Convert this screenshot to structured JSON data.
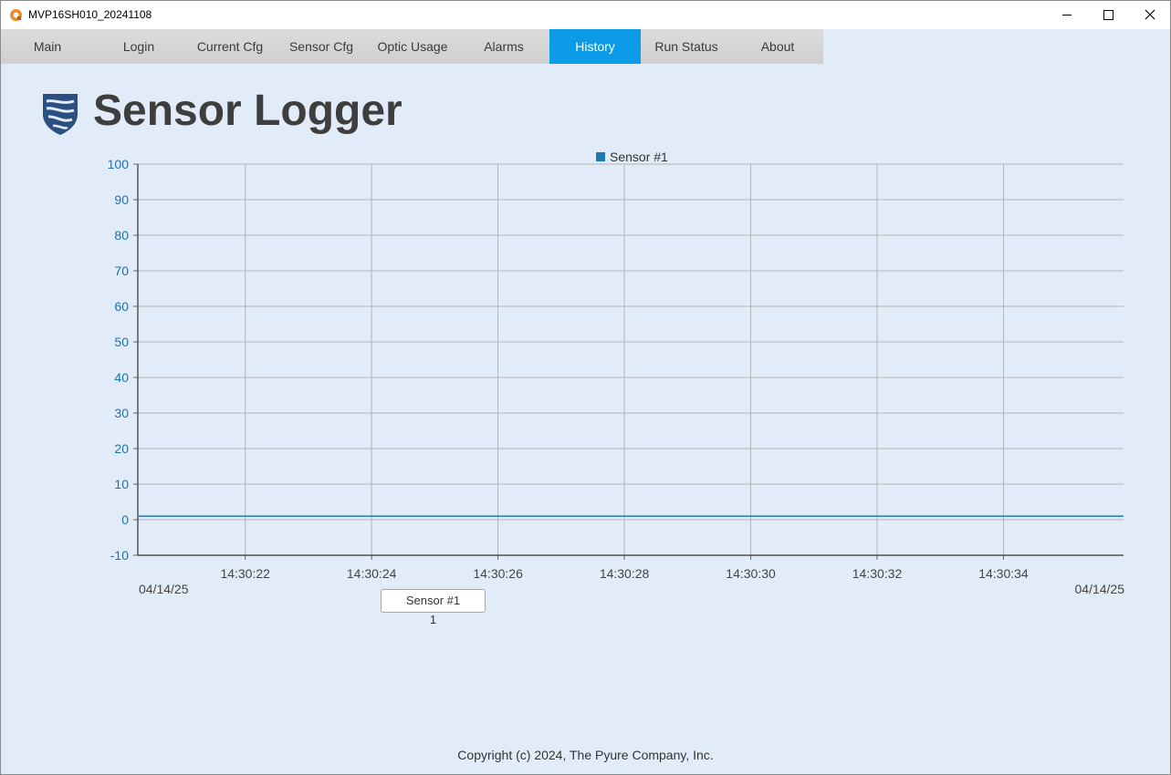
{
  "window": {
    "title": "MVP16SH010_20241108",
    "controls": [
      "minimize-icon",
      "maximize-icon",
      "close-icon"
    ]
  },
  "tabs": [
    {
      "label": "Main",
      "active": false
    },
    {
      "label": "Login",
      "active": false
    },
    {
      "label": "Current Cfg",
      "active": false
    },
    {
      "label": "Sensor Cfg",
      "active": false
    },
    {
      "label": "Optic Usage",
      "active": false
    },
    {
      "label": "Alarms",
      "active": false
    },
    {
      "label": "History",
      "active": true
    },
    {
      "label": "Run Status",
      "active": false
    },
    {
      "label": "About",
      "active": false
    }
  ],
  "colors": {
    "accent": "#0c9be6",
    "background": "#e1ecf8",
    "series": "#1f78b4",
    "axis_text": "#1a73b0",
    "logo": "#2c4f82"
  },
  "header": {
    "app_name": "Sensor Logger",
    "logo_icon": "shield-icon"
  },
  "chart_data": {
    "type": "line",
    "title": "",
    "xlabel": "",
    "ylabel": "",
    "ylim": [
      -10,
      100
    ],
    "y_ticks": [
      "-10",
      "0",
      "10",
      "20",
      "30",
      "40",
      "50",
      "60",
      "70",
      "80",
      "90",
      "100"
    ],
    "xlim": [
      "14:30:20.3",
      "14:30:35.9"
    ],
    "x_ticks": [
      "14:30:22",
      "14:30:24",
      "14:30:26",
      "14:30:28",
      "14:30:30",
      "14:30:32",
      "14:30:34"
    ],
    "x_start_date": "04/14/25",
    "x_end_date": "04/14/25",
    "legend": {
      "position": "top",
      "entries": [
        "Sensor #1"
      ]
    },
    "grid": true,
    "series": [
      {
        "name": "Sensor #1",
        "x": [
          "14:30:20.3",
          "14:30:35.9"
        ],
        "values": [
          1,
          1
        ]
      }
    ]
  },
  "sensor_buttons": [
    {
      "label": "Sensor #1",
      "value": "1"
    }
  ],
  "footer": {
    "copyright": "Copyright (c) 2024, The Pyure Company, Inc."
  }
}
